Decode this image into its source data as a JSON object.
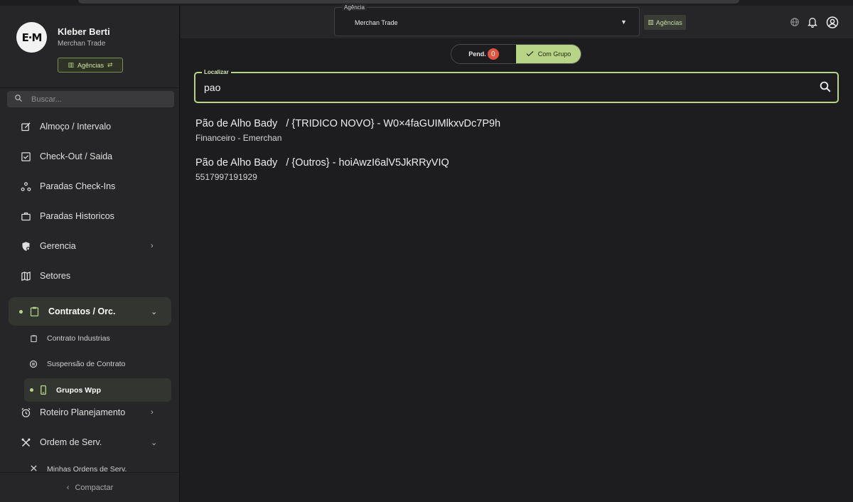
{
  "sidebar": {
    "user": {
      "name": "Kleber Berti",
      "company": "Merchan Trade",
      "logo_text": "E·M"
    },
    "agency_button": "Agências",
    "search_placeholder": "Buscar...",
    "items": [
      {
        "label": "Almoço / Intervalo",
        "icon": "edit-square-icon"
      },
      {
        "label": "Check-Out / Saida",
        "icon": "checkbox-icon"
      },
      {
        "label": "Paradas Check-Ins",
        "icon": "nodes-icon"
      },
      {
        "label": "Paradas Historicos",
        "icon": "briefcase-icon"
      },
      {
        "label": "Gerencia",
        "icon": "shield-gear-icon"
      },
      {
        "label": "Setores",
        "icon": "map-icon"
      },
      {
        "label": "Contratos / Orc.",
        "icon": "clipboard-icon"
      },
      {
        "label": "Roteiro Planejamento",
        "icon": "alarm-icon"
      },
      {
        "label": "Ordem de Serv.",
        "icon": "tools-icon"
      }
    ],
    "subitems": [
      {
        "label": "Contrato Industrias",
        "icon": "clipboard-icon"
      },
      {
        "label": "Suspensão de Contrato",
        "icon": "pause-circle-icon"
      },
      {
        "label": "Grupos Wpp",
        "icon": "phone-icon"
      },
      {
        "label": "Minhas Ordens de Serv.",
        "icon": "tools-icon"
      }
    ],
    "collapse_label": "Compactar"
  },
  "header": {
    "agency_select_legend": "Agência",
    "agency_select_value": "Merchan Trade",
    "agency_chip": "Agências"
  },
  "toggle": {
    "pending_label": "Pend.",
    "pending_count": "0",
    "group_label": "Com Grupo"
  },
  "search": {
    "legend": "Localizar",
    "value": "pao"
  },
  "results": [
    {
      "title": "Pão de Alho Bady   / {TRIDICO NOVO} - W0×4faGUIMlkxvDc7P9h",
      "subtitle": "Financeiro - Emerchan"
    },
    {
      "title": "Pão de Alho Bady   / {Outros} - hoiAwzI6alV5JkRRyVIQ",
      "subtitle": "5517997191929"
    }
  ],
  "colors": {
    "accent": "#b8d486",
    "badge": "#e0533f",
    "sidebar_bg": "#262628",
    "main_bg": "#1d1d1f"
  }
}
